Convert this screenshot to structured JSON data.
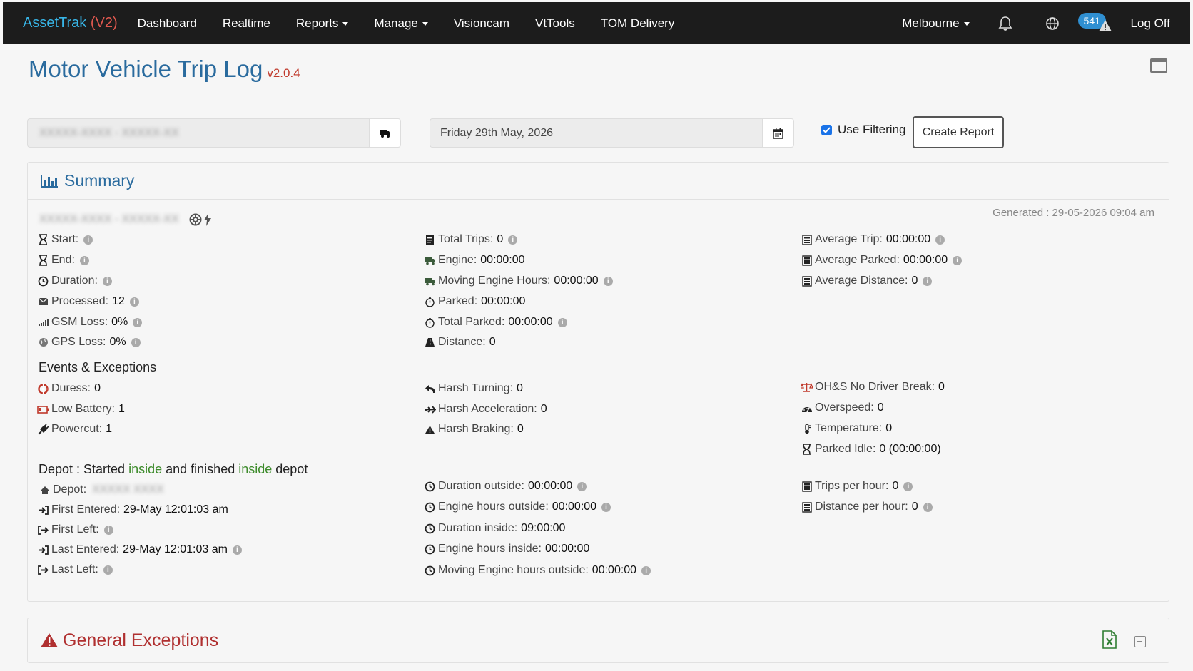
{
  "nav": {
    "brand": "AssetTrak",
    "brand_version": "(V2)",
    "items": [
      "Dashboard",
      "Realtime",
      "Reports",
      "Manage",
      "Visioncam",
      "VtTools",
      "TOM Delivery"
    ],
    "location": "Melbourne",
    "alert_count": "541",
    "logoff": "Log Off"
  },
  "page": {
    "title": "Motor Vehicle Trip Log",
    "version": "v2.0.4"
  },
  "filters": {
    "vehicle_value": "XXXXX-XXXX - XXXXX-XX",
    "date_value": "Friday 29th May, 2026",
    "use_filtering_label": "Use Filtering",
    "use_filtering_checked": true,
    "create_report_label": "Create Report"
  },
  "summary": {
    "title": "Summary",
    "vehicle_name": "XXXXX-XXXX - XXXXX-XX",
    "generated": "Generated : 29-05-2026 09:04 am",
    "col1": [
      {
        "label": "Start:",
        "value": "",
        "icon": "hourglass-icon",
        "info": true
      },
      {
        "label": "End:",
        "value": "",
        "icon": "hourglass-icon",
        "info": true
      },
      {
        "label": "Duration:",
        "value": "",
        "icon": "clock-icon",
        "info": true
      },
      {
        "label": "Processed:",
        "value": "12",
        "icon": "envelope-icon",
        "info": true
      },
      {
        "label": "GSM Loss:",
        "value": "0%",
        "icon": "signal-icon",
        "info": true
      },
      {
        "label": "GPS Loss:",
        "value": "0%",
        "icon": "globe-icon",
        "info": true
      }
    ],
    "col2": [
      {
        "label": "Total Trips:",
        "value": "0",
        "icon": "document-icon",
        "info": true
      },
      {
        "label": "Engine:",
        "value": "00:00:00",
        "icon": "truck-icon",
        "info": false
      },
      {
        "label": "Moving Engine Hours:",
        "value": "00:00:00",
        "icon": "truck-icon",
        "info": true
      },
      {
        "label": "Parked:",
        "value": "00:00:00",
        "icon": "timer-icon",
        "info": false
      },
      {
        "label": "Total Parked:",
        "value": "00:00:00",
        "icon": "timer-icon",
        "info": true
      },
      {
        "label": "Distance:",
        "value": "0",
        "icon": "road-icon",
        "info": false
      }
    ],
    "col3": [
      {
        "label": "Average Trip:",
        "value": "00:00:00",
        "icon": "calculator-icon",
        "info": true
      },
      {
        "label": "Average Parked:",
        "value": "00:00:00",
        "icon": "calculator-icon",
        "info": true
      },
      {
        "label": "Average Distance:",
        "value": "0",
        "icon": "calculator-icon",
        "info": true
      }
    ],
    "events_title": "Events & Exceptions",
    "events_col1": [
      {
        "label": "Duress:",
        "value": "0",
        "icon": "lifebuoy-icon"
      },
      {
        "label": "Low Battery:",
        "value": "1",
        "icon": "battery-icon"
      },
      {
        "label": "Powercut:",
        "value": "1",
        "icon": "plug-icon"
      }
    ],
    "events_col2": [
      {
        "label": "Harsh Turning:",
        "value": "0",
        "icon": "turn-icon"
      },
      {
        "label": "Harsh Acceleration:",
        "value": "0",
        "icon": "plane-icon"
      },
      {
        "label": "Harsh Braking:",
        "value": "0",
        "icon": "warning-icon"
      }
    ],
    "events_col3": [
      {
        "label": "OH&S No Driver Break:",
        "value": "0",
        "icon": "scale-icon"
      },
      {
        "label": "Overspeed:",
        "value": "0",
        "icon": "gauge-icon"
      },
      {
        "label": "Temperature:",
        "value": "0",
        "icon": "thermometer-icon"
      },
      {
        "label": "Parked Idle:",
        "value": "0 (00:00:00)",
        "icon": "hourglass-icon"
      }
    ],
    "depot": {
      "prefix": "Depot : Started",
      "word1": "inside",
      "middle": "and finished",
      "word2": "inside",
      "suffix": "depot",
      "depot_label": "Depot:",
      "depot_value": "XXXXX XXXX",
      "col1": [
        {
          "label": "First Entered:",
          "value": "29-May 12:01:03 am",
          "icon": "sign-in-icon",
          "info": false
        },
        {
          "label": "First Left:",
          "value": "",
          "icon": "sign-out-icon",
          "info": true
        },
        {
          "label": "Last Entered:",
          "value": "29-May 12:01:03 am",
          "icon": "sign-in-icon",
          "info": true
        },
        {
          "label": "Last Left:",
          "value": "",
          "icon": "sign-out-icon",
          "info": true
        }
      ],
      "col2": [
        {
          "label": "Duration outside:",
          "value": "00:00:00",
          "icon": "clock-icon",
          "info": true
        },
        {
          "label": "Engine hours outside:",
          "value": "00:00:00",
          "icon": "clock-icon",
          "info": true
        },
        {
          "label": "Duration inside:",
          "value": "09:00:00",
          "icon": "clock-icon",
          "info": false
        },
        {
          "label": "Engine hours inside:",
          "value": "00:00:00",
          "icon": "clock-icon",
          "info": false
        },
        {
          "label": "Moving Engine hours outside:",
          "value": "00:00:00",
          "icon": "clock-icon",
          "info": true
        }
      ],
      "col3": [
        {
          "label": "Trips per hour:",
          "value": "0",
          "icon": "calculator-icon",
          "info": true
        },
        {
          "label": "Distance per hour:",
          "value": "0",
          "icon": "calculator-icon",
          "info": true
        }
      ]
    }
  },
  "exceptions": {
    "title": "General Exceptions"
  }
}
